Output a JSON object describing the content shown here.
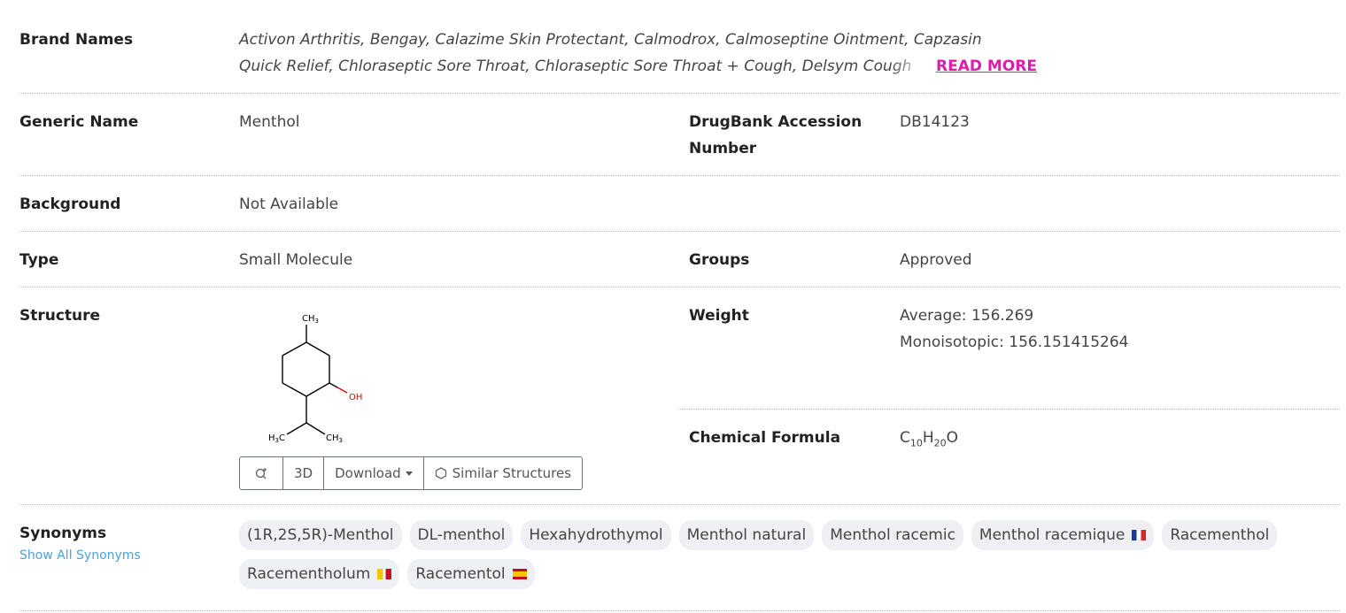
{
  "brand_names": {
    "label": "Brand Names",
    "line1": "Activon Arthritis, Bengay, Calazime Skin Protectant, Calmodrox, Calmoseptine Ointment, Capzasin",
    "line2": "Quick Relief, Chloraseptic Sore Throat, Chloraseptic Sore Throat + Cough, Delsym Cough",
    "read_more": "READ MORE"
  },
  "generic_name": {
    "label": "Generic Name",
    "value": "Menthol"
  },
  "accession": {
    "label_line1": "DrugBank Accession",
    "label_line2": "Number",
    "value": "DB14123"
  },
  "background": {
    "label": "Background",
    "value": "Not Available"
  },
  "type": {
    "label": "Type",
    "value": "Small Molecule"
  },
  "groups": {
    "label": "Groups",
    "value": "Approved"
  },
  "structure": {
    "label": "Structure",
    "atoms": {
      "ch3_top": "CH",
      "ch3_top_sub": "3",
      "oh": "OH",
      "h3c": "H",
      "h3c_sub": "3",
      "h3c_c": "C",
      "ch3_right": "CH",
      "ch3_right_sub": "3"
    },
    "buttons": {
      "zoom_icon": "magnify-icon",
      "three_d": "3D",
      "download": "Download",
      "similar": "Similar Structures"
    }
  },
  "weight": {
    "label": "Weight",
    "average": "Average: 156.269",
    "mono": "Monoisotopic: 156.151415264"
  },
  "formula": {
    "label": "Chemical Formula",
    "c": "C",
    "c_n": "10",
    "h": "H",
    "h_n": "20",
    "o": "O"
  },
  "synonyms": {
    "label": "Synonyms",
    "show_all": "Show All Synonyms",
    "items": [
      {
        "text": "(1R,2S,5R)-Menthol"
      },
      {
        "text": "DL-menthol"
      },
      {
        "text": "Hexahydrothymol"
      },
      {
        "text": "Menthol natural"
      },
      {
        "text": "Menthol racemic"
      },
      {
        "text": "Menthol racemique",
        "flag": "flag-france-icon"
      },
      {
        "text": "Racementhol"
      },
      {
        "text": "Racementholum",
        "flag": "flag-latin-icon"
      },
      {
        "text": "Racementol",
        "flag": "flag-spain-icon"
      }
    ]
  },
  "colors": {
    "accent_link": "#e01cae",
    "show_all_link": "#4aa3df",
    "pill_bg": "#eef0f3",
    "oh_red": "#e00000"
  }
}
